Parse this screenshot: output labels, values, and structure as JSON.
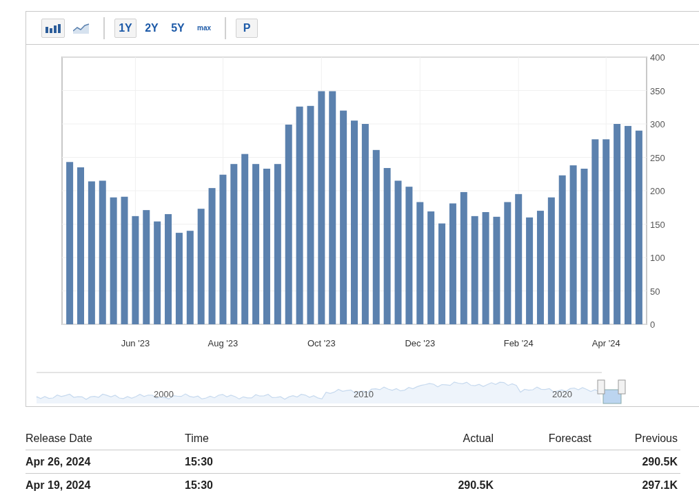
{
  "toolbar": {
    "chart_types": [
      {
        "kind": "bar",
        "selected": true
      },
      {
        "kind": "line",
        "selected": false
      }
    ],
    "ranges": [
      {
        "label": "1Y",
        "selected": true
      },
      {
        "label": "2Y",
        "selected": false
      },
      {
        "label": "5Y",
        "selected": false
      },
      {
        "label": "max",
        "selected": false
      }
    ],
    "extra_button": "P"
  },
  "chart_data": {
    "type": "bar",
    "categories": [
      null,
      null,
      null,
      null,
      null,
      null,
      "Jun '23",
      null,
      null,
      null,
      null,
      null,
      null,
      null,
      "Aug '23",
      null,
      null,
      null,
      null,
      null,
      null,
      null,
      null,
      "Oct '23",
      null,
      null,
      null,
      null,
      null,
      null,
      null,
      null,
      "Dec '23",
      null,
      null,
      null,
      null,
      null,
      null,
      null,
      null,
      "Feb '24",
      null,
      null,
      null,
      null,
      null,
      null,
      null,
      "Apr '24",
      null,
      null,
      null
    ],
    "series": [
      {
        "color": "#5b81ae",
        "values": [
          243,
          235,
          214,
          215,
          190,
          191,
          162,
          171,
          154,
          165,
          137,
          140,
          173,
          204,
          224,
          240,
          255,
          240,
          233,
          240,
          299,
          326,
          327,
          349,
          349,
          320,
          305,
          300,
          261,
          234,
          215,
          206,
          183,
          169,
          151,
          181,
          198,
          162,
          168,
          161,
          183,
          195,
          160,
          170,
          190,
          223,
          238,
          233,
          277,
          277,
          300,
          297,
          290
        ]
      }
    ],
    "grid": true,
    "ylim": [
      0,
      400
    ],
    "yticks": [
      0,
      50,
      100,
      150,
      200,
      250,
      300,
      350,
      400
    ]
  },
  "navigator": {
    "labels": [
      "2000",
      "2010",
      "2020"
    ]
  },
  "table": {
    "columns": [
      "Release Date",
      "Time",
      "Actual",
      "Forecast",
      "Previous"
    ],
    "rows": [
      {
        "release_date": "Apr 26, 2024",
        "time": "15:30",
        "previous": "290.5K"
      },
      {
        "release_date": "Apr 19, 2024",
        "time": "15:30",
        "actual": "290.5K",
        "previous": "297.1K"
      }
    ]
  }
}
